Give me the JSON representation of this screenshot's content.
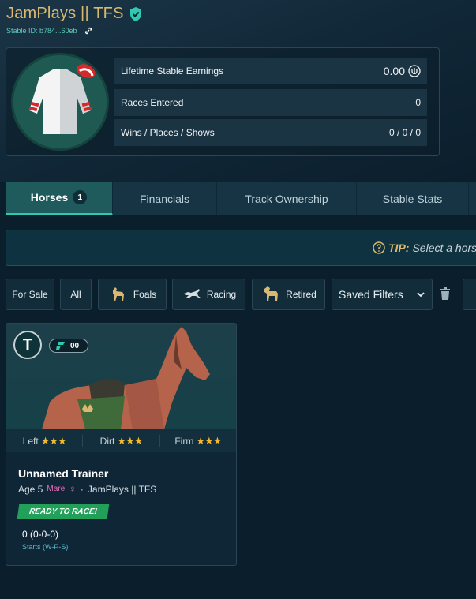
{
  "header": {
    "stable_name": "JamPlays || TFS",
    "stable_id": "Stable ID: b784...60eb"
  },
  "stats": {
    "earnings_label": "Lifetime Stable Earnings",
    "earnings_value": "0.00",
    "races_label": "Races Entered",
    "races_value": "0",
    "wps_label": "Wins / Places / Shows",
    "wps_value": "0 / 0 / 0"
  },
  "tabs": [
    {
      "label": "Horses",
      "count": "1",
      "active": true
    },
    {
      "label": "Financials"
    },
    {
      "label": "Track Ownership"
    },
    {
      "label": "Stable Stats"
    }
  ],
  "tip": {
    "label": "TIP:",
    "text": "Select a hors"
  },
  "filters": {
    "for_sale": "For Sale",
    "all": "All",
    "foals": "Foals",
    "racing": "Racing",
    "retired": "Retired",
    "saved": "Saved Filters"
  },
  "horse_card": {
    "trainer_initial": "T",
    "gate": "00",
    "preferences": [
      {
        "label": "Left",
        "stars": "★★★"
      },
      {
        "label": "Dirt",
        "stars": "★★★"
      },
      {
        "label": "Firm",
        "stars": "★★★"
      }
    ],
    "name": "Unnamed Trainer",
    "age": "Age 5",
    "sex": "Mare",
    "sex_symbol": "♀",
    "owner": "JamPlays || TFS",
    "status": "READY TO RACE!",
    "record": "0 (0-0-0)",
    "record_label": "Starts (W-P-S)"
  },
  "colors": {
    "accent_gold": "#d9b870",
    "accent_teal": "#2ec9b3",
    "ready_green": "#22a05a",
    "star": "#f3b92a"
  }
}
